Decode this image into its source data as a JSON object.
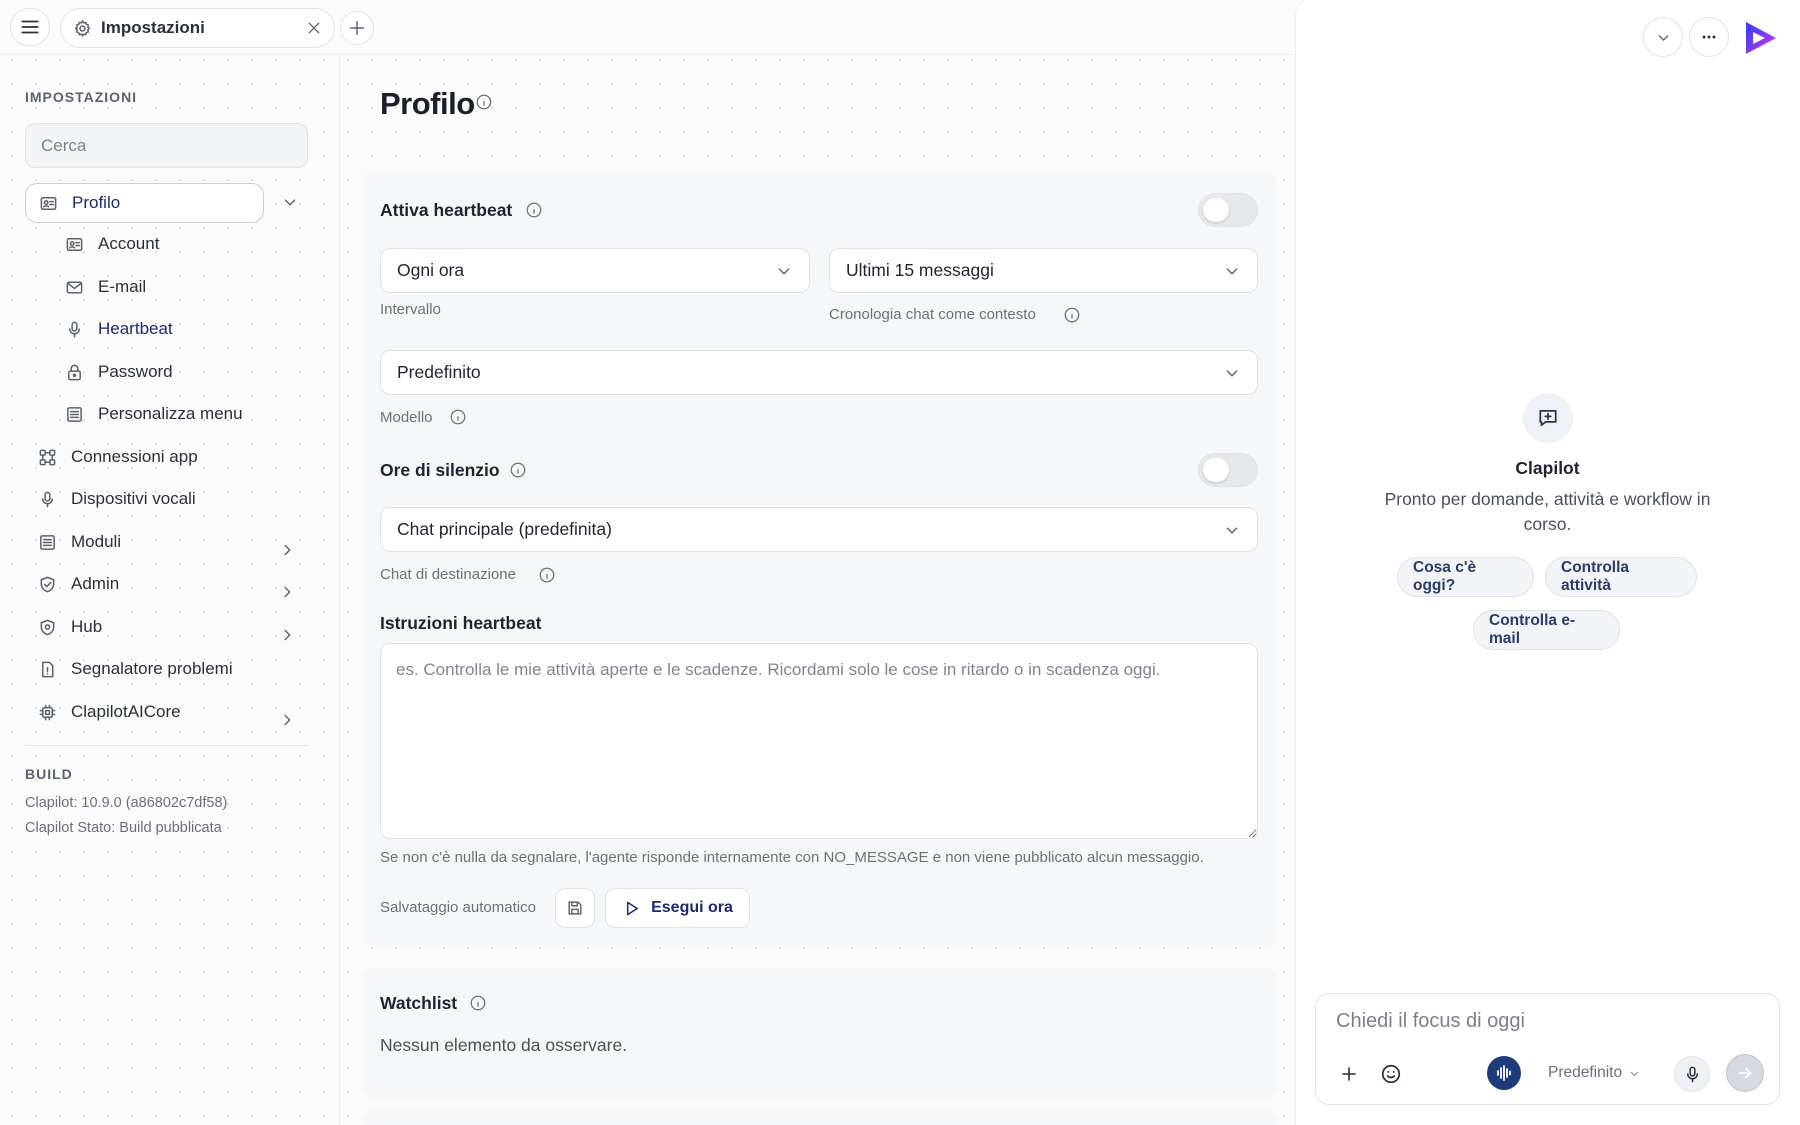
{
  "tab": {
    "title": "Impostazioni"
  },
  "sidebar": {
    "heading": "IMPOSTAZIONI",
    "search_placeholder": "Cerca",
    "active": {
      "label": "Profilo"
    },
    "subitems": [
      {
        "label": "Account",
        "icon": "id-card-icon"
      },
      {
        "label": "E-mail",
        "icon": "mail-icon"
      },
      {
        "label": "Heartbeat",
        "icon": "mic-icon"
      },
      {
        "label": "Password",
        "icon": "lock-icon"
      },
      {
        "label": "Personalizza menu",
        "icon": "list-icon"
      }
    ],
    "items": [
      {
        "label": "Connessioni app",
        "icon": "nodes-icon"
      },
      {
        "label": "Dispositivi vocali",
        "icon": "mic-icon"
      },
      {
        "label": "Moduli",
        "icon": "list-icon"
      },
      {
        "label": "Admin",
        "icon": "shield-check-icon"
      },
      {
        "label": "Hub",
        "icon": "shield-icon"
      },
      {
        "label": "Segnalatore problemi",
        "icon": "document-icon"
      },
      {
        "label": "ClapilotAICore",
        "icon": "chip-icon"
      }
    ],
    "build": {
      "heading": "BUILD",
      "version": "Clapilot: 10.9.0 (a86802c7df58)",
      "status": "Clapilot Stato: Build pubblicata"
    }
  },
  "main": {
    "title": "Profilo",
    "heartbeat": {
      "label": "Attiva heartbeat",
      "enabled": false,
      "interval": {
        "value": "Ogni ora",
        "label": "Intervallo"
      },
      "history": {
        "value": "Ultimi 15 messaggi",
        "label": "Cronologia chat come contesto"
      },
      "model": {
        "value": "Predefinito",
        "label": "Modello"
      }
    },
    "quiet_hours": {
      "label": "Ore di silenzio",
      "enabled": false
    },
    "destination": {
      "value": "Chat principale (predefinita)",
      "label": "Chat di destinazione"
    },
    "instructions": {
      "label": "Istruzioni heartbeat",
      "placeholder": "es. Controlla le mie attività aperte e le scadenze. Ricordami solo le cose in ritardo o in scadenza oggi.",
      "value": ""
    },
    "note": "Se non c'è nulla da segnalare, l'agente risponde internamente con NO_MESSAGE e non viene pubblicato alcun messaggio.",
    "autosave_label": "Salvataggio automatico",
    "run_label": "Esegui ora",
    "watchlist": {
      "label": "Watchlist",
      "empty": "Nessun elemento da osservare."
    }
  },
  "assistant": {
    "name": "Clapilot",
    "description": "Pronto per domande, attività e workflow in corso.",
    "chips": [
      "Cosa c'è oggi?",
      "Controlla attività",
      "Controlla e-mail"
    ],
    "composer_placeholder": "Chiedi il focus di oggi",
    "model": "Predefinito"
  },
  "colors": {
    "accent": "#1d2a6b",
    "voice": "#1f3c7a",
    "logo_a": "#2b3cff",
    "logo_b": "#d63adf"
  }
}
